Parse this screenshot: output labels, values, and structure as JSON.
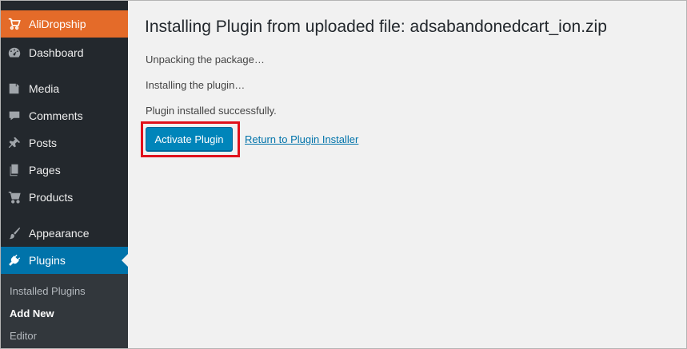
{
  "sidebar": {
    "items": [
      {
        "label": "AliDropship",
        "icon": "cart-icon"
      },
      {
        "label": "Dashboard",
        "icon": "dashboard-icon"
      },
      {
        "label": "Media",
        "icon": "media-icon"
      },
      {
        "label": "Comments",
        "icon": "comments-icon"
      },
      {
        "label": "Posts",
        "icon": "pin-icon"
      },
      {
        "label": "Pages",
        "icon": "pages-icon"
      },
      {
        "label": "Products",
        "icon": "cart-icon"
      },
      {
        "label": "Appearance",
        "icon": "brush-icon"
      },
      {
        "label": "Plugins",
        "icon": "plug-icon"
      }
    ],
    "submenu": [
      {
        "label": "Installed Plugins"
      },
      {
        "label": "Add New"
      },
      {
        "label": "Editor"
      }
    ]
  },
  "main": {
    "title": "Installing Plugin from uploaded file: adsabandonedcart_ion.zip",
    "messages": [
      "Unpacking the package…",
      "Installing the plugin…",
      "Plugin installed successfully."
    ],
    "activate_label": "Activate Plugin",
    "return_label": "Return to Plugin Installer"
  },
  "colors": {
    "sidebar_bg": "#23282d",
    "brand": "#e46b29",
    "active": "#0073aa",
    "button": "#0085ba",
    "highlight": "#e0111b"
  }
}
